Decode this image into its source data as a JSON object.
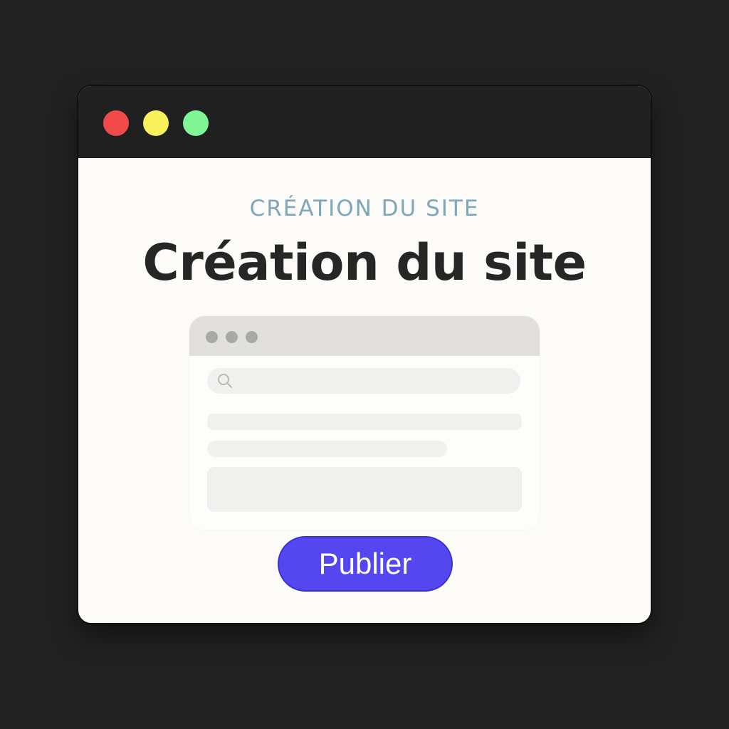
{
  "window": {
    "controls": [
      {
        "name": "close",
        "color": "#f24a4a"
      },
      {
        "name": "minimize",
        "color": "#f7f25b"
      },
      {
        "name": "maximize",
        "color": "#7ff596"
      }
    ]
  },
  "content": {
    "overline": "CRÉATION DU SITE",
    "title": "Création du site",
    "publish_label": "Publier"
  },
  "mockup": {
    "search_icon": "search-icon"
  },
  "colors": {
    "overline": "#7ea7bb",
    "accent": "#5447f0",
    "title": "#262626"
  }
}
